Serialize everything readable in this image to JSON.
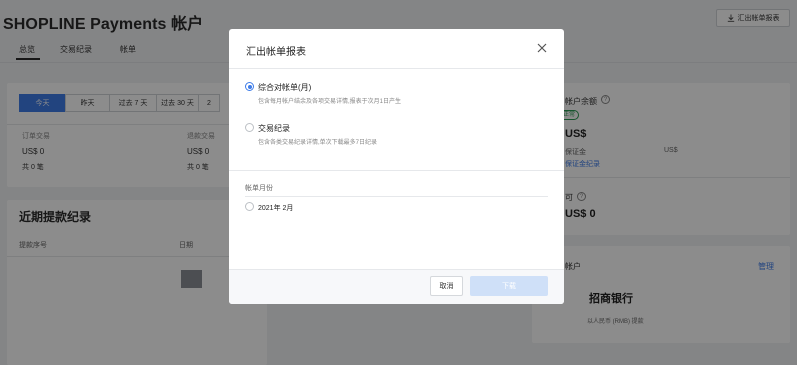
{
  "header": {
    "title": "SHOPLINE Payments 帐户",
    "export_label": "汇出帐单报表"
  },
  "tabs": [
    {
      "label": "总览"
    },
    {
      "label": "交易纪录"
    },
    {
      "label": "帐单"
    }
  ],
  "ranges": [
    {
      "label": "今天"
    },
    {
      "label": "昨天"
    },
    {
      "label": "过去 7 天"
    },
    {
      "label": "过去 30 天"
    },
    {
      "label": "2"
    }
  ],
  "stats": {
    "left_label": "订单交易",
    "left_amount": "US$ 0",
    "left_count": "共 0 笔",
    "right_label": "退款交易",
    "right_amount": "US$ 0",
    "right_count": "共 0 笔"
  },
  "payouts": {
    "title": "近期提款纪录",
    "col_id": "提款序号",
    "col_date": "日期"
  },
  "balance": {
    "label": "帐户余额",
    "badge": "正常",
    "amount": "US$",
    "reserve_label": "保证金",
    "reserve_amount": "US$",
    "reserve_link": "保证金纪录",
    "pending_label": "可",
    "pending_amount": "US$ 0"
  },
  "bank": {
    "label": "帐户",
    "manage": "管理",
    "name": "招商银行",
    "currency_note": "以人民币 (RMB) 提款"
  },
  "modal": {
    "title": "汇出帐单报表",
    "option1_label": "综合对帐单(月)",
    "option1_desc": "包含每月帐户结余及各项交易详情,报表于次月1日产生",
    "option2_label": "交易纪录",
    "option2_desc": "包含各类交易纪录详情,单次下载最多7日纪录",
    "month_section": "帐单月份",
    "month_option": "2021年 2月",
    "cancel": "取消",
    "download": "下载"
  },
  "colors": {
    "accent": "#3e7ce8",
    "badge_green": "#2b9a54",
    "overlay": "rgba(0,0,0,0.45)"
  }
}
